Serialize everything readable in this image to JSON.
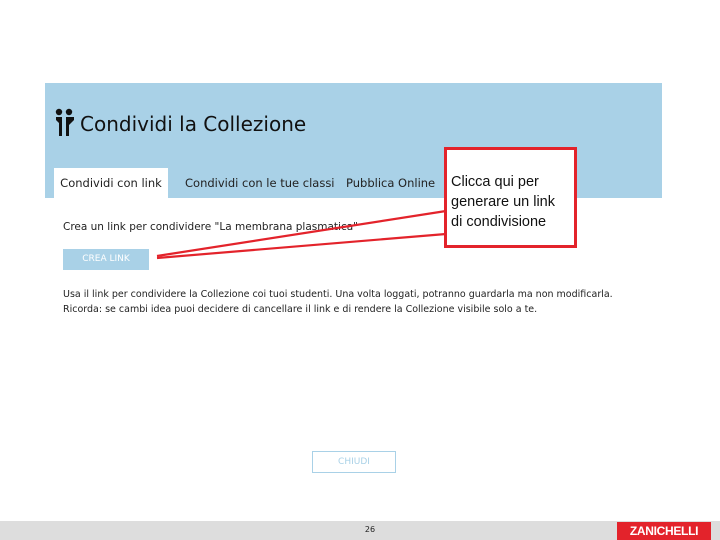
{
  "dialog": {
    "title": "Condividi la Collezione",
    "tabs": [
      {
        "label": "Condividi con link"
      },
      {
        "label": "Condividi con le tue classi"
      },
      {
        "label": "Pubblica Online"
      }
    ],
    "instruction": "Crea un link per condividere \"La membrana plasmatica\"",
    "create_link_label": "CREA LINK",
    "info_line_1": "Usa il link per condividere la Collezione coi tuoi studenti. Una volta loggati, potranno guardarla ma non modificarla.",
    "info_line_2": "Ricorda: se cambi idea puoi decidere di cancellare il link e di rendere la Collezione visibile solo a te.",
    "close_label": "CHIUDI"
  },
  "callout": {
    "text": "Clicca qui per generare un link di condivisione"
  },
  "footer": {
    "page_number": "26",
    "brand": "ZANICHELLI"
  },
  "colors": {
    "header_band": "#a9d1e7",
    "callout_border": "#e3232b",
    "brand": "#e3232b",
    "footer_bar": "#dddddd"
  }
}
